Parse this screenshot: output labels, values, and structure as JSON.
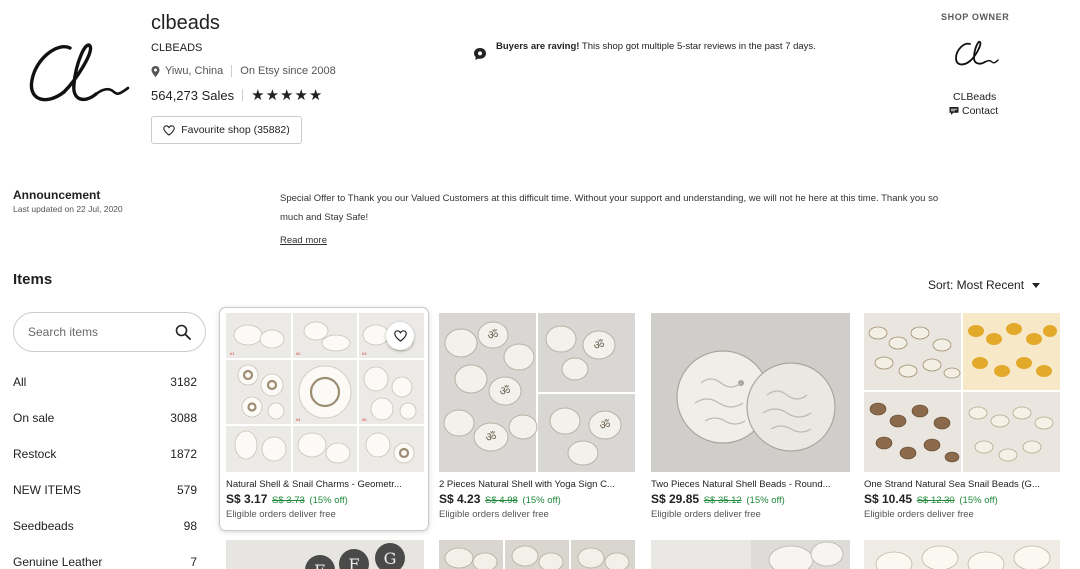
{
  "shop": {
    "name": "clbeads",
    "handle": "CLBEADS",
    "location": "Yiwu, China",
    "since": "On Etsy since 2008",
    "sales": "564,273 Sales",
    "stars": "★★★★★",
    "favourite_button": "Favourite shop (35882)"
  },
  "raving": {
    "bold": "Buyers are raving!",
    "text": " This shop got multiple 5-star reviews in the past 7 days."
  },
  "owner": {
    "label": "SHOP OWNER",
    "name": "CLBeads",
    "contact": "Contact"
  },
  "announcement": {
    "title": "Announcement",
    "updated": "Last updated on 22 Jul, 2020",
    "text": "Special Offer to Thank you our Valued Customers at this difficult time. Without your support and understanding, we will not he here at this time. Thank you so much and Stay Safe!",
    "read_more": "Read more"
  },
  "items": {
    "title": "Items",
    "sort_label": "Sort: Most Recent",
    "search_placeholder": "Search items",
    "categories": [
      {
        "label": "All",
        "count": "3182"
      },
      {
        "label": "On sale",
        "count": "3088"
      },
      {
        "label": "Restock",
        "count": "1872"
      },
      {
        "label": "NEW ITEMS",
        "count": "579"
      },
      {
        "label": "Seedbeads",
        "count": "98"
      },
      {
        "label": "Genuine Leather",
        "count": "7"
      }
    ]
  },
  "products": [
    {
      "title": "Natural Shell & Snail Charms - Geometr...",
      "price": "S$ 3.17",
      "was": "S$ 3.73",
      "off": "(15% off)",
      "shipping": "Eligible orders deliver free"
    },
    {
      "title": "2 Pieces Natural Shell with Yoga Sign C...",
      "price": "S$ 4.23",
      "was": "S$ 4.98",
      "off": "(15% off)",
      "shipping": "Eligible orders deliver free"
    },
    {
      "title": "Two Pieces Natural Shell Beads - Round...",
      "price": "S$ 29.85",
      "was": "S$ 35.12",
      "off": "(15% off)",
      "shipping": "Eligible orders deliver free"
    },
    {
      "title": "One Strand Natural Sea Snail Beads (G...",
      "price": "S$ 10.45",
      "was": "S$ 12.30",
      "off": "(15% off)",
      "shipping": "Eligible orders deliver free"
    }
  ],
  "bottom_row_letters": [
    "E",
    "F",
    "G"
  ],
  "colors": {
    "sale_green": "#1f8a3b",
    "text": "#222222",
    "border": "#cccccc"
  }
}
